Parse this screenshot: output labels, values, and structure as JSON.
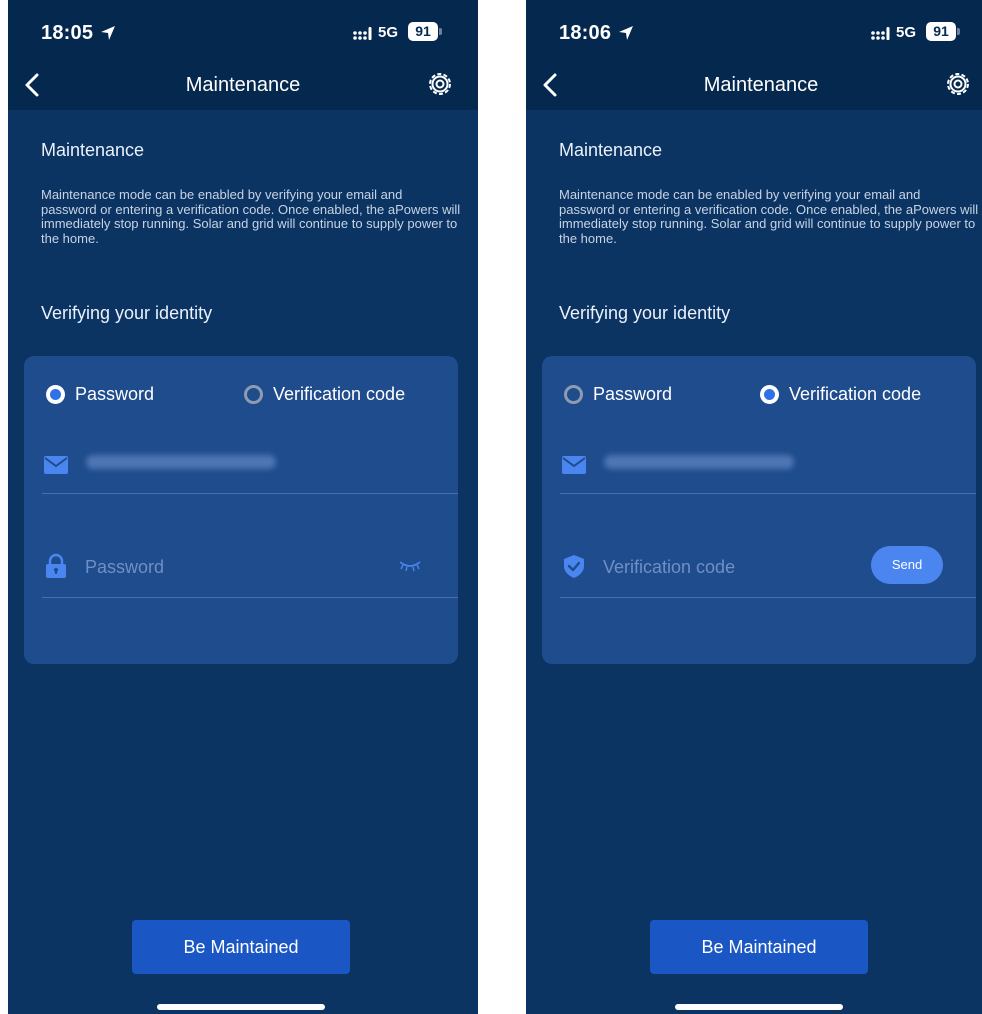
{
  "screens": [
    {
      "status_bar": {
        "time": "18:05",
        "network": "5G",
        "battery": "91"
      },
      "header": {
        "title": "Maintenance"
      },
      "section_title": "Maintenance",
      "description": "Maintenance mode can be enabled by verifying your email and password or entering a verification code. Once enabled, the aPowers will immediately stop running. Solar and grid will continue to supply power to the home.",
      "verify_title": "Verifying your identity",
      "options": {
        "password": "Password",
        "verification_code": "Verification code",
        "selected": "Password"
      },
      "second_field": {
        "placeholder": "Password",
        "icon": "lock-icon",
        "trailing": "eye-closed-icon"
      },
      "primary_button": "Be Maintained"
    },
    {
      "status_bar": {
        "time": "18:06",
        "network": "5G",
        "battery": "91"
      },
      "header": {
        "title": "Maintenance"
      },
      "section_title": "Maintenance",
      "description": "Maintenance mode can be enabled by verifying your email and password or entering a verification code. Once enabled, the aPowers will immediately stop running. Solar and grid will continue to supply power to the home.",
      "verify_title": "Verifying your identity",
      "options": {
        "password": "Password",
        "verification_code": "Verification code",
        "selected": "Verification code"
      },
      "second_field": {
        "placeholder": "Verification code",
        "icon": "shield-check-icon",
        "trailing_button": "Send"
      },
      "primary_button": "Be Maintained"
    }
  ],
  "colors": {
    "background": "#0b3463",
    "header": "#05284e",
    "card": "#1e4c8c",
    "accent": "#2f72e6",
    "button": "#1a57c5"
  }
}
